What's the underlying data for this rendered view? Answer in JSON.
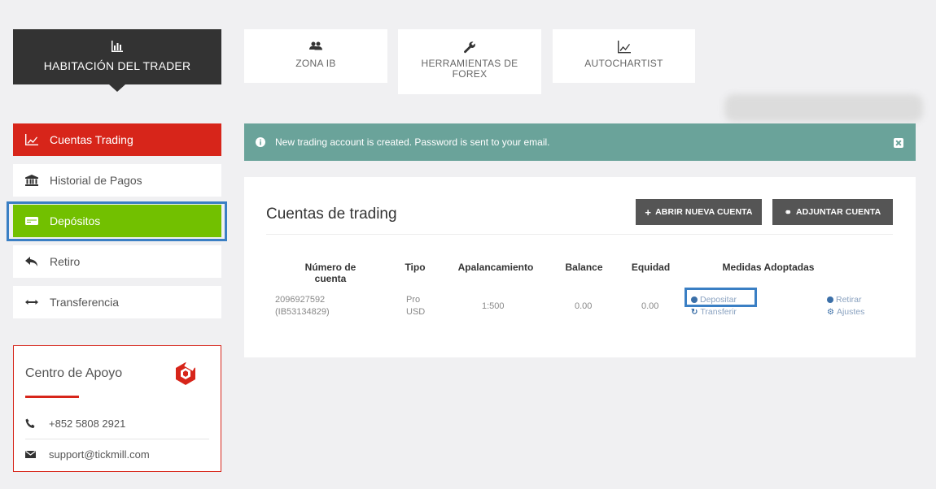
{
  "header": {
    "trader_room": "HABITACIÓN DEL TRADER",
    "tiles": {
      "zona_ib": "ZONA IB",
      "herramientas_line1": "HERRAMIENTAS DE",
      "herramientas_line2": "FOREX",
      "autochartist": "AUTOCHARTIST"
    }
  },
  "sidebar": {
    "items": [
      {
        "label": "Cuentas Trading",
        "icon": "line-chart-icon"
      },
      {
        "label": "Historial de Pagos",
        "icon": "bank-icon"
      },
      {
        "label": "Depósitos",
        "icon": "card-icon"
      },
      {
        "label": "Retiro",
        "icon": "reply-icon"
      },
      {
        "label": "Transferencia",
        "icon": "arrows-horizontal-icon"
      }
    ],
    "support": {
      "title": "Centro de Apoyo",
      "phone": "+852 5808 2921",
      "email": "support@tickmill.com"
    }
  },
  "alert": {
    "message": "New trading account is created. Password is sent to your email."
  },
  "main": {
    "title": "Cuentas de trading",
    "open_account": "ABRIR NUEVA CUENTA",
    "attach_account": "ADJUNTAR CUENTA",
    "columns": [
      "Número de cuenta",
      "Tipo",
      "Apalancamiento",
      "Balance",
      "Equidad",
      "Medidas Adoptadas"
    ],
    "row": {
      "account_number": "2096927592",
      "account_id": "(IB53134829)",
      "type_line1": "Pro",
      "type_line2": "USD",
      "leverage": "1:500",
      "balance": "0.00",
      "equity": "0.00",
      "actions": {
        "deposit": "Depositar",
        "transfer": "Transferir",
        "withdraw": "Retirar",
        "settings": "Ajustes"
      }
    }
  },
  "colors": {
    "brand_red": "#d7251a",
    "deposit_green": "#72c000",
    "alert_teal": "#6aa39a",
    "highlight_blue": "#3a7fc4"
  }
}
